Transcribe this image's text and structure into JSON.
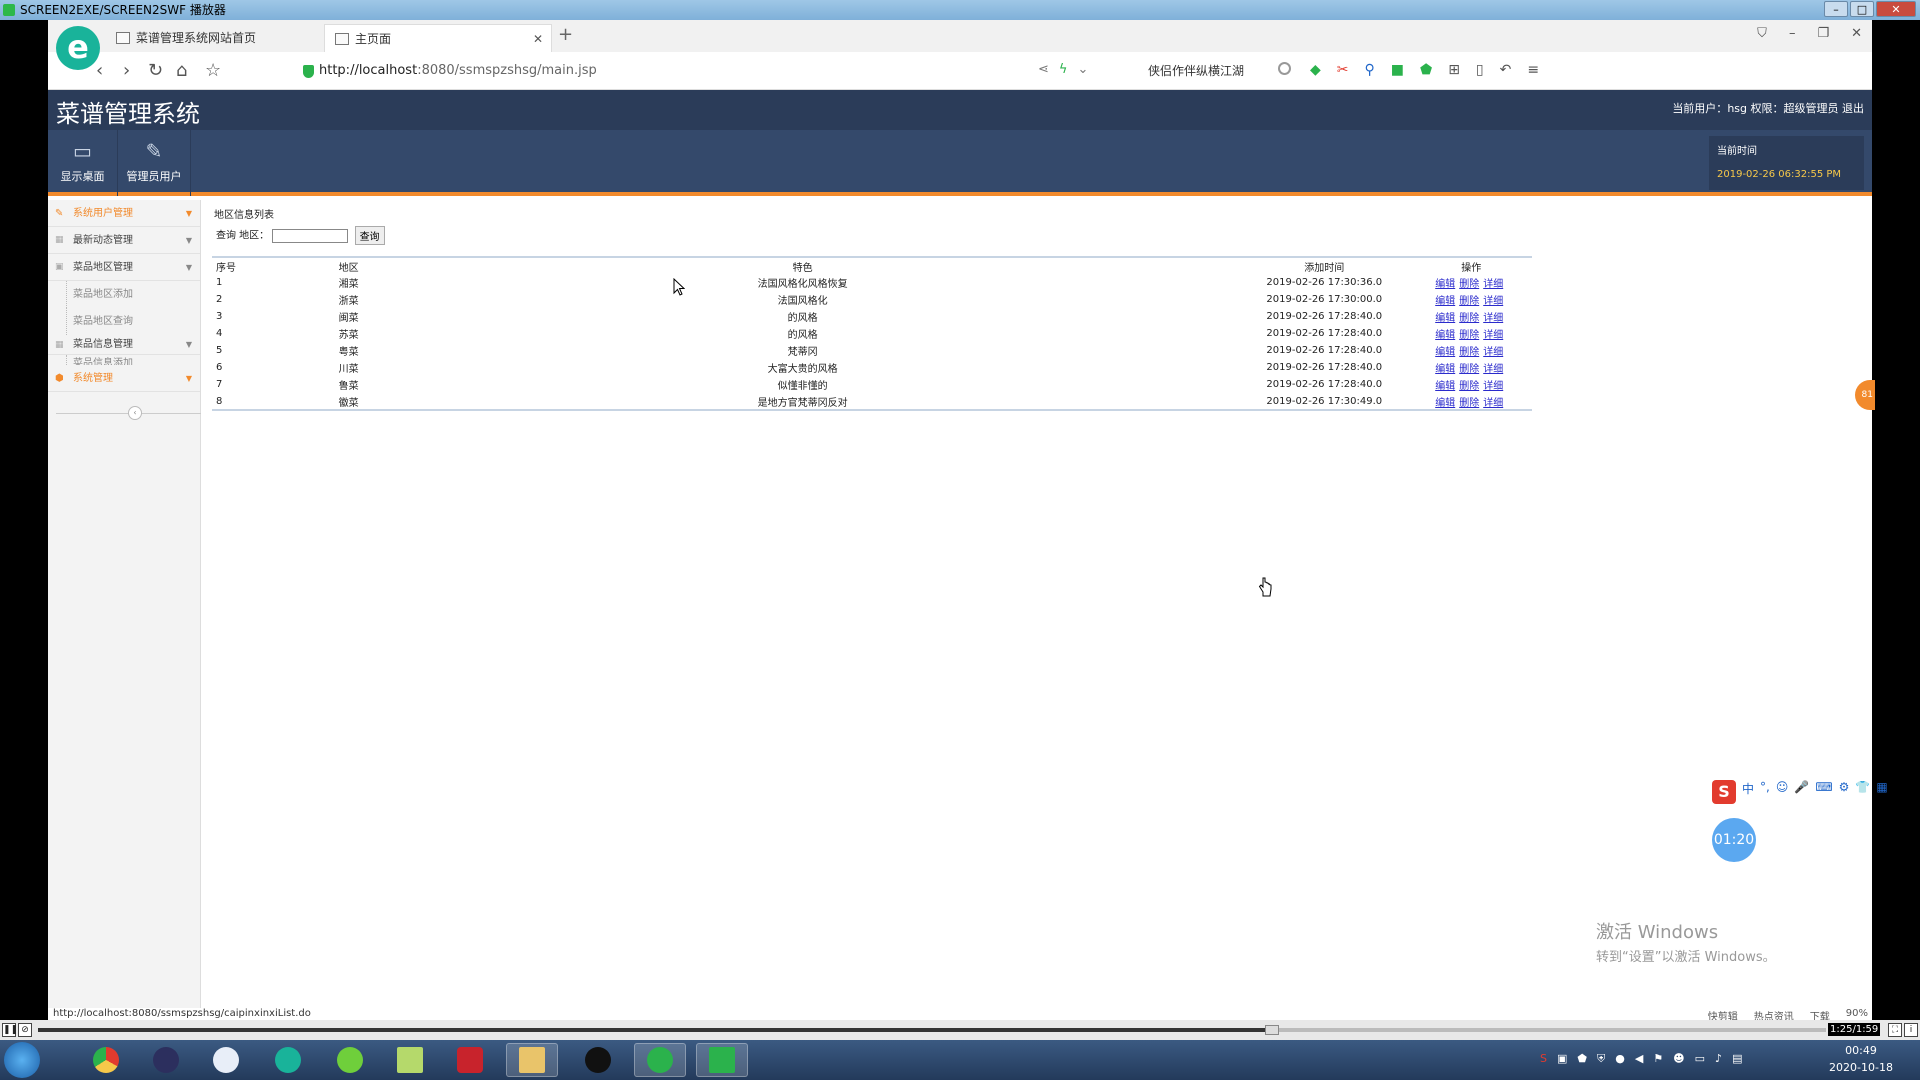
{
  "player": {
    "title": "SCREEN2EXE/SCREEN2SWF 播放器",
    "time": "1:25/1:59",
    "progress": 0.69
  },
  "browser": {
    "tabs": [
      {
        "label": "菜谱管理系统网站首页"
      },
      {
        "label": "主页面"
      }
    ],
    "url_host": "http://localhost",
    "url_rest": ":8080/ssmspzshsg/main.jsp",
    "search_text": "侠侣作伴纵横江湖",
    "status_url": "http://localhost:8080/ssmspzshsg/caipinxinxiList.do",
    "status_tools": [
      "快剪辑",
      "热点资讯",
      "下载",
      "90%"
    ]
  },
  "app": {
    "title": "菜谱管理系统",
    "user_prefix": "当前用户：",
    "username": "hsg",
    "role_prefix": "权限：",
    "role": "超级管理员",
    "logout": "退出",
    "toolbar": [
      {
        "label": "显示桌面",
        "icon": "monitor-icon"
      },
      {
        "label": "管理员用户",
        "icon": "pencil-icon"
      }
    ],
    "time_label": "当前时间",
    "time_value": "2019-02-26 06:32:55 PM"
  },
  "sidebar": {
    "items": [
      {
        "label": "系统用户管理"
      },
      {
        "label": "最新动态管理"
      },
      {
        "label": "菜品地区管理"
      },
      {
        "label": "菜品地区添加"
      },
      {
        "label": "菜品地区查询"
      },
      {
        "label": "菜品信息管理"
      },
      {
        "label": "菜品信息添加"
      },
      {
        "label": "系统管理"
      }
    ]
  },
  "content": {
    "section_title": "地区信息列表",
    "search_label": "查询 地区：",
    "search_value": "",
    "search_button": "查询",
    "columns": [
      "序号",
      "地区",
      "特色",
      "添加时间",
      "操作"
    ],
    "actions": [
      "编辑",
      "删除",
      "详细"
    ],
    "rows": [
      {
        "no": "1",
        "region": "湘菜",
        "feature": "法国风格化风格恢复",
        "time": "2019-02-26 17:30:36.0"
      },
      {
        "no": "2",
        "region": "浙菜",
        "feature": "法国风格化",
        "time": "2019-02-26 17:30:00.0"
      },
      {
        "no": "3",
        "region": "闽菜",
        "feature": "的风格",
        "time": "2019-02-26 17:28:40.0"
      },
      {
        "no": "4",
        "region": "苏菜",
        "feature": "的风格",
        "time": "2019-02-26 17:28:40.0"
      },
      {
        "no": "5",
        "region": "粤菜",
        "feature": "梵蒂冈",
        "time": "2019-02-26 17:28:40.0"
      },
      {
        "no": "6",
        "region": "川菜",
        "feature": "大富大贵的风格",
        "time": "2019-02-26 17:28:40.0"
      },
      {
        "no": "7",
        "region": "鲁菜",
        "feature": "似懂非懂的",
        "time": "2019-02-26 17:28:40.0"
      },
      {
        "no": "8",
        "region": "徽菜",
        "feature": "是地方官梵蒂冈反对",
        "time": "2019-02-26 17:30:49.0"
      }
    ]
  },
  "overlay": {
    "badge": "81",
    "ime_char": "中",
    "timer": "01:20",
    "activate_line1": "激活 Windows",
    "activate_line2": "转到“设置”以激活 Windows。"
  },
  "taskbar": {
    "clock_time": "00:49",
    "clock_date": "2020-10-18",
    "colors": {
      "accent": "#f28a2c",
      "header": "#2b3c59",
      "toolbar": "#34496b"
    }
  }
}
